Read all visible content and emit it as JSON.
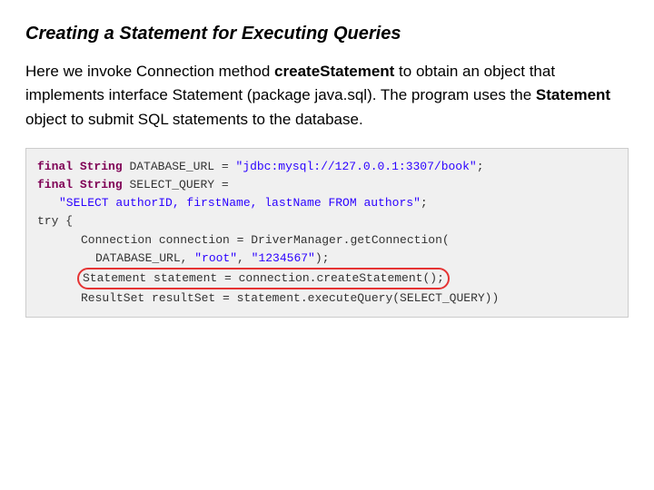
{
  "title": "Creating a Statement for Executing Queries",
  "description": {
    "text_before_bold1": "Here we invoke Connection method ",
    "bold1": "createStatement",
    "text_after_bold1": " to obtain an object that implements interface Statement (package java.sql). The program uses the ",
    "bold2": "Statement",
    "text_after_bold2": " object to submit SQL statements to the database."
  },
  "code": {
    "lines": [
      "final String DATABASE_URL = \"jdbc:mysql://127.0.0.1:3307/book\";",
      "final String SELECT_QUERY =",
      "   \"SELECT authorID, firstName, lastName FROM authors\";",
      "try {",
      "    Connection connection = DriverManager.getConnection(",
      "        DATABASE_URL, \"root\", \"1234567\");",
      "    Statement statement = connection.createStatement();",
      "    ResultSet resultSet = statement.executeQuery(SELECT_QUERY))"
    ]
  },
  "colors": {
    "keyword": "#7f0055",
    "string": "#2a00ff",
    "highlight_border": "#e53333",
    "background": "#f0f0f0"
  }
}
